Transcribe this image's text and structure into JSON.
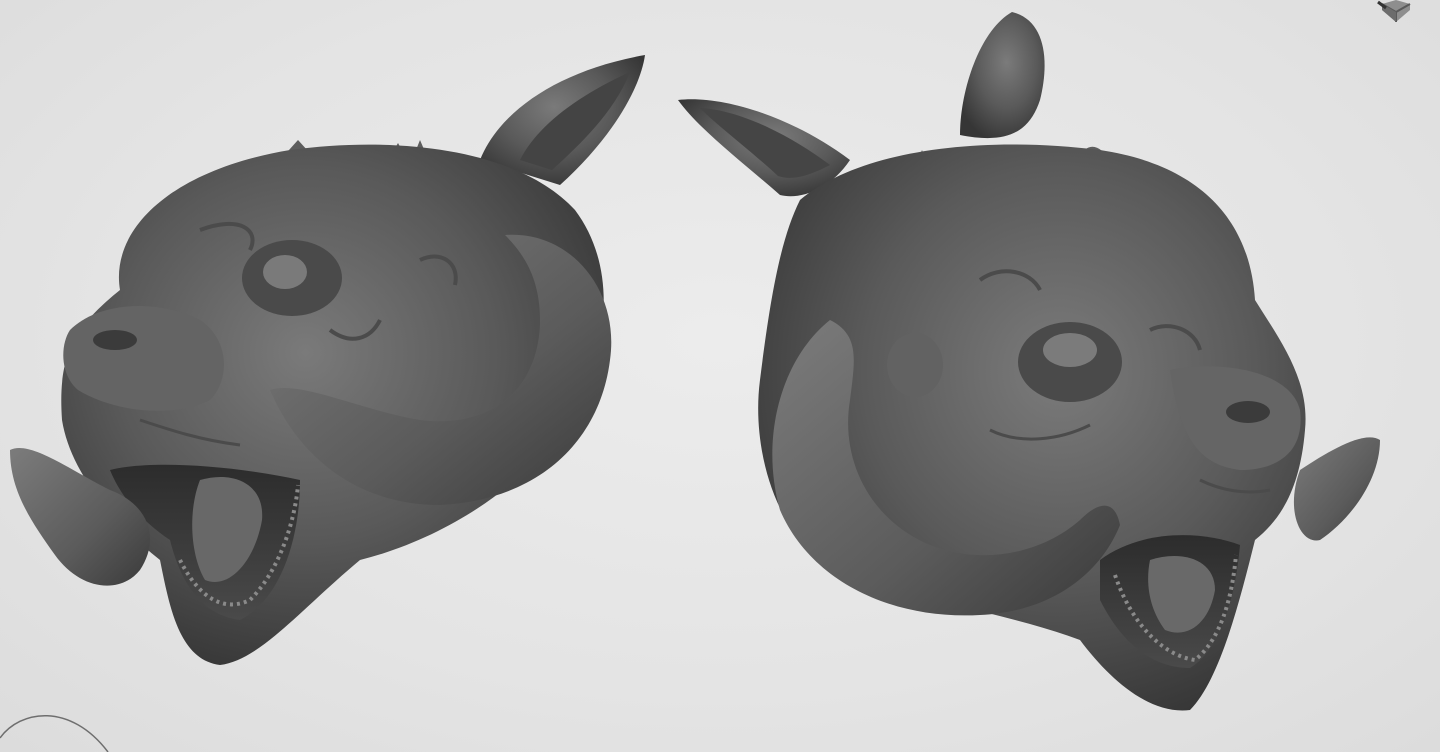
{
  "viewport": {
    "background_color": "#e5e5e5",
    "model_color": "#5a5a5a",
    "models": [
      {
        "name": "creature-head-left-view",
        "icon": "sculpt-mesh"
      },
      {
        "name": "creature-head-right-view",
        "icon": "sculpt-mesh"
      }
    ]
  },
  "overlays": {
    "nav_cube_icon": "view-cube-icon",
    "orbit_gizmo_icon": "orbit-circle-icon"
  }
}
